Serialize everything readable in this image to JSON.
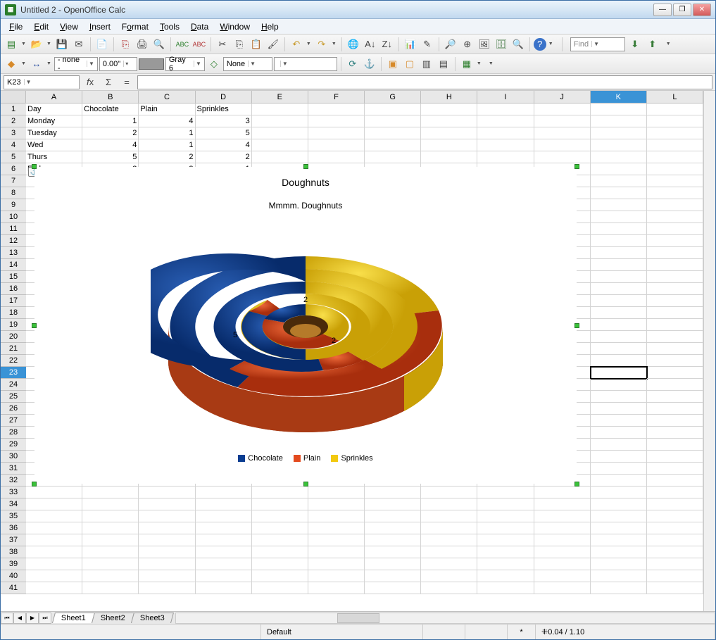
{
  "window": {
    "title": "Untitled 2 - OpenOffice Calc"
  },
  "menu": [
    "File",
    "Edit",
    "View",
    "Insert",
    "Format",
    "Tools",
    "Data",
    "Window",
    "Help"
  ],
  "toolbar2": {
    "line_style": "- none -",
    "line_width": "0.00\"",
    "color_name": "Gray 6",
    "area_fill": "None"
  },
  "find": {
    "placeholder": "Find"
  },
  "formula": {
    "name_box": "K23",
    "value": ""
  },
  "columns": [
    "A",
    "B",
    "C",
    "D",
    "E",
    "F",
    "G",
    "H",
    "I",
    "J",
    "K",
    "L"
  ],
  "row_count": 41,
  "selected_col": "K",
  "selected_row": 23,
  "table": {
    "headers": [
      "Day",
      "Chocolate",
      "Plain",
      "Sprinkles"
    ],
    "rows": [
      [
        "Monday",
        1,
        4,
        3
      ],
      [
        "Tuesday",
        2,
        1,
        5
      ],
      [
        "Wed",
        4,
        1,
        4
      ],
      [
        "Thurs",
        5,
        2,
        2
      ],
      [
        "Friday",
        2,
        3,
        1
      ]
    ]
  },
  "chart": {
    "title": "Doughnuts",
    "subtitle": "Mmmm. Doughnuts",
    "legend": [
      {
        "name": "Chocolate",
        "color": "#0a3d91"
      },
      {
        "name": "Plain",
        "color": "#e34a1e"
      },
      {
        "name": "Sprinkles",
        "color": "#f2c90f"
      }
    ],
    "labels": [
      "5",
      "2",
      "2"
    ]
  },
  "chart_data": {
    "type": "pie",
    "subtype": "doughnut-3d-multi-ring",
    "title": "Doughnuts",
    "subtitle": "Mmmm. Doughnuts",
    "series": [
      {
        "name": "Chocolate",
        "color": "#0a3d91",
        "values": [
          1,
          2,
          4,
          5,
          2
        ]
      },
      {
        "name": "Plain",
        "color": "#e34a1e",
        "values": [
          4,
          1,
          1,
          2,
          3
        ]
      },
      {
        "name": "Sprinkles",
        "color": "#f2c90f",
        "values": [
          3,
          5,
          4,
          2,
          1
        ]
      }
    ],
    "categories": [
      "Monday",
      "Tuesday",
      "Wed",
      "Thurs",
      "Friday"
    ],
    "visible_data_labels": [
      5,
      2,
      2
    ],
    "legend_position": "bottom"
  },
  "sheets": [
    "Sheet1",
    "Sheet2",
    "Sheet3"
  ],
  "active_sheet": "Sheet1",
  "status": {
    "style": "Default",
    "modified": "*",
    "coords": "0.04 / 1.10"
  }
}
